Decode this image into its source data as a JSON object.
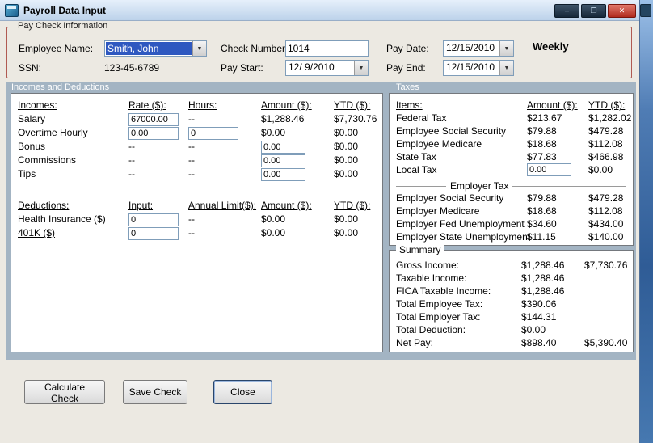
{
  "window": {
    "title": "Payroll Data Input"
  },
  "icons": {
    "dropdown": "▼",
    "minimize": "–",
    "maximize": "❐",
    "close": "✕"
  },
  "colors": {
    "section_header_bg": "#a3b4c3",
    "paycheck_group_border": "#b05a52",
    "combo_selection": "#2e58c0",
    "titlebar_top": "#e6f0fb",
    "titlebar_bottom": "#bcd2ea",
    "close_button": "#b02a1d"
  },
  "paycheck": {
    "group_label": "Pay Check Information",
    "employee_name_label": "Employee Name:",
    "employee_name_value": "Smith, John",
    "ssn_label": "SSN:",
    "ssn_value": "123-45-6789",
    "check_number_label": "Check Number:",
    "check_number_value": "1014",
    "pay_start_label": "Pay Start:",
    "pay_start_value": "12/ 9/2010",
    "pay_date_label": "Pay Date:",
    "pay_date_value": "12/15/2010",
    "pay_end_label": "Pay End:",
    "pay_end_value": "12/15/2010",
    "frequency": "Weekly"
  },
  "sections": {
    "incomes": "Incomes and Deductions",
    "taxes": "Taxes"
  },
  "incomes": {
    "headers": [
      "Incomes:",
      "Rate ($):",
      "Hours:",
      "Amount ($):",
      "YTD ($):"
    ],
    "rows": [
      {
        "label": "Salary",
        "rate": "67000.00",
        "hours": "--",
        "amount": "$1,288.46",
        "ytd": "$7,730.76"
      },
      {
        "label": "Overtime Hourly",
        "rate": "0.00",
        "hours": "0",
        "amount": "$0.00",
        "ytd": "$0.00"
      },
      {
        "label": "Bonus",
        "rate": "--",
        "hours": "--",
        "amount": "0.00",
        "ytd": "$0.00"
      },
      {
        "label": "Commissions",
        "rate": "--",
        "hours": "--",
        "amount": "0.00",
        "ytd": "$0.00"
      },
      {
        "label": "Tips",
        "rate": "--",
        "hours": "--",
        "amount": "0.00",
        "ytd": "$0.00"
      }
    ]
  },
  "deductions": {
    "headers": [
      "Deductions:",
      "Input:",
      "Annual Limit($):",
      "Amount ($):",
      "YTD ($):"
    ],
    "rows": [
      {
        "label": "Health Insurance ($)",
        "input": "0",
        "limit": "--",
        "amount": "$0.00",
        "ytd": "$0.00"
      },
      {
        "label": "401K ($)",
        "input": "0",
        "limit": "--",
        "amount": "$0.00",
        "ytd": "$0.00"
      }
    ]
  },
  "taxes": {
    "headers": [
      "Items:",
      "Amount ($):",
      "YTD ($):"
    ],
    "employee_rows": [
      {
        "label": "Federal Tax",
        "amount": "$213.67",
        "ytd": "$1,282.02"
      },
      {
        "label": "Employee Social Security",
        "amount": "$79.88",
        "ytd": "$479.28"
      },
      {
        "label": "Employee Medicare",
        "amount": "$18.68",
        "ytd": "$112.08"
      },
      {
        "label": "State Tax",
        "amount": "$77.83",
        "ytd": "$466.98"
      },
      {
        "label": "Local Tax",
        "amount": "0.00",
        "ytd": "$0.00"
      }
    ],
    "employer_header": "Employer Tax",
    "employer_rows": [
      {
        "label": "Employer Social Security",
        "amount": "$79.88",
        "ytd": "$479.28"
      },
      {
        "label": "Employer Medicare",
        "amount": "$18.68",
        "ytd": "$112.08"
      },
      {
        "label": "Employer Fed Unemployment",
        "amount": "$34.60",
        "ytd": "$434.00"
      },
      {
        "label": "Employer State Unemployment",
        "amount": "$11.15",
        "ytd": "$140.00"
      }
    ]
  },
  "summary": {
    "group_label": "Summary",
    "rows": [
      {
        "label": "Gross Income:",
        "amount": "$1,288.46",
        "ytd": "$7,730.76"
      },
      {
        "label": "Taxable Income:",
        "amount": "$1,288.46",
        "ytd": ""
      },
      {
        "label": "FICA Taxable Income:",
        "amount": "$1,288.46",
        "ytd": ""
      },
      {
        "label": "Total Employee Tax:",
        "amount": "$390.06",
        "ytd": ""
      },
      {
        "label": "Total Employer Tax:",
        "amount": "$144.31",
        "ytd": ""
      },
      {
        "label": "Total Deduction:",
        "amount": "$0.00",
        "ytd": ""
      },
      {
        "label": "Net Pay:",
        "amount": "$898.40",
        "ytd": "$5,390.40"
      }
    ]
  },
  "buttons": {
    "calculate": "Calculate Check",
    "save": "Save Check",
    "close": "Close"
  }
}
